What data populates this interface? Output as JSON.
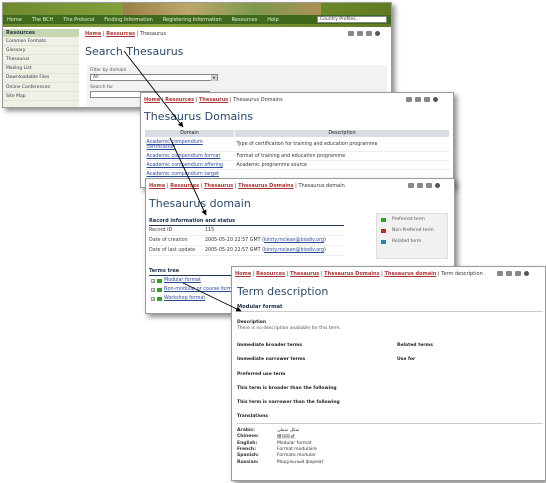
{
  "w1": {
    "nav": [
      "Home",
      "The BCH",
      "The Protocol",
      "Finding Information",
      "Registering Information",
      "Resources",
      "Help"
    ],
    "country_select": "Country Profiles...",
    "sidebar_head": "Resources",
    "sidebar": [
      "Common Formats",
      "Glossary",
      "Thesaurus",
      "Mailing List",
      "Downloadable Files",
      "Online Conferences",
      "Site Map"
    ],
    "crumb": {
      "home": "Home",
      "resources": "Resources",
      "current": "Thesaurus"
    },
    "title": "Search Thesaurus",
    "filter_label": "Filter by domain",
    "filter_value": "All",
    "search_label": "Search for"
  },
  "w2": {
    "crumb": {
      "home": "Home",
      "resources": "Resources",
      "thesaurus": "Thesaurus",
      "current": "Thesaurus Domains"
    },
    "title": "Thesaurus Domains",
    "headers": [
      "Domain",
      "Description"
    ],
    "rows": [
      [
        "Academic compendium certification",
        "Type of certification for training and education programme"
      ],
      [
        "Academic compendium format",
        "Format of training and education programme"
      ],
      [
        "Academic compendium offering",
        "Academic programme source"
      ],
      [
        "Academic compendium target",
        ""
      ]
    ]
  },
  "w3": {
    "crumb": {
      "home": "Home",
      "resources": "Resources",
      "thesaurus": "Thesaurus",
      "domains": "Thesaurus Domains",
      "current": "Thesaurus domain"
    },
    "title": "Thesaurus domain",
    "record_head": "Record information and status",
    "record": [
      {
        "k": "Record ID",
        "v": "115",
        "link": ""
      },
      {
        "k": "Date of creation",
        "v": "2005-05-20 22:57 GMT",
        "link": "kirsty.mclean@biodiv.org"
      },
      {
        "k": "Date of last update",
        "v": "2005-05-20 22:57 GMT",
        "link": "kirsty.mclean@biodiv.org"
      }
    ],
    "legend": [
      {
        "label": "Preferred term",
        "color": "#3a9a2a"
      },
      {
        "label": "Non-Prefered term",
        "color": "#b03030"
      },
      {
        "label": "Related term",
        "color": "#2a8a9a"
      }
    ],
    "tree_head": "Terms tree",
    "tree": [
      "Modular format",
      "Non-modular or course format",
      "Workshop format"
    ]
  },
  "w4": {
    "crumb": {
      "home": "Home",
      "resources": "Resources",
      "thesaurus": "Thesaurus",
      "domains": "Thesaurus Domains",
      "domain": "Thesaurus domain",
      "current": "Term description"
    },
    "title": "Term description",
    "term": "Modular format",
    "desc_head": "Description",
    "desc": "There is no description available for this term.",
    "labels": {
      "broader": "Immediate broader terms",
      "related": "Related terms",
      "narrower": "Immediate narrower terms",
      "usefor": "Use for",
      "preferred": "Preferred use term",
      "broader_than": "This term is broader than the following",
      "narrower_than": "This term is narrower than the following",
      "translations": "Translations"
    },
    "translations": [
      {
        "k": "Arabic:",
        "v": "شكل نمطي"
      },
      {
        "k": "Chinese:",
        "v": "模块形式"
      },
      {
        "k": "English:",
        "v": "Modular format"
      },
      {
        "k": "French:",
        "v": "Format modulaire"
      },
      {
        "k": "Spanish:",
        "v": "Formato modular"
      },
      {
        "k": "Russian:",
        "v": "Модульный формат"
      }
    ]
  }
}
